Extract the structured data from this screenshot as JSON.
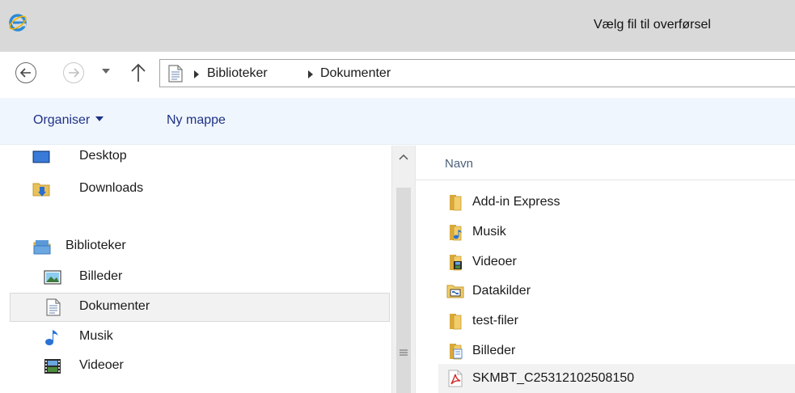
{
  "window": {
    "title": "Vælg fil til overførsel"
  },
  "navigation": {
    "breadcrumb": [
      "Biblioteker",
      "Dokumenter"
    ]
  },
  "toolbar": {
    "organize_label": "Organiser",
    "new_folder_label": "Ny mappe"
  },
  "nav_pane": {
    "items": [
      {
        "label": "Desktop",
        "icon": "desktop-icon"
      },
      {
        "label": "Downloads",
        "icon": "downloads-folder-icon"
      },
      {
        "label": "Biblioteker",
        "icon": "libraries-icon"
      },
      {
        "label": "Billeder",
        "icon": "pictures-icon"
      },
      {
        "label": "Dokumenter",
        "icon": "documents-icon",
        "selected": true
      },
      {
        "label": "Musik",
        "icon": "music-icon"
      },
      {
        "label": "Videoer",
        "icon": "videos-icon"
      }
    ]
  },
  "file_list": {
    "column_header": "Navn",
    "items": [
      {
        "label": "Add-in Express",
        "icon": "folder-icon"
      },
      {
        "label": "Musik",
        "icon": "music-folder-icon"
      },
      {
        "label": "Videoer",
        "icon": "video-folder-icon"
      },
      {
        "label": "Datakilder",
        "icon": "datasource-folder-icon"
      },
      {
        "label": "test-filer",
        "icon": "folder-icon"
      },
      {
        "label": "Billeder",
        "icon": "pictures-folder-icon"
      },
      {
        "label": "SKMBT_C25312102508150",
        "icon": "pdf-icon"
      }
    ]
  },
  "colors": {
    "titlebar_bg": "#d9d9d9",
    "toolbar_bg": "#f0f6fd",
    "toolbar_text": "#1e3287",
    "selected_bg": "#f2f2f2",
    "folder_yellow": "#e8c15a"
  }
}
